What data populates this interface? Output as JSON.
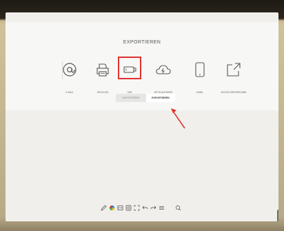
{
  "dialog": {
    "title": "EXPORTIEREN"
  },
  "options": [
    {
      "label": "E-MAIL",
      "icon": "at-sign-icon"
    },
    {
      "label": "DRUCKEN",
      "icon": "printer-icon"
    },
    {
      "label": "USB",
      "icon": "usb-drive-icon"
    },
    {
      "label": "NETZLAUFWERK",
      "icon": "cloud-icon"
    },
    {
      "label": "MOBIL",
      "icon": "mobile-phone-icon"
    },
    {
      "label": "BILDSCHIRMFREIGABE",
      "icon": "share-screen-icon"
    }
  ],
  "tabs": [
    {
      "label": "IMPORTIEREN",
      "active": false
    },
    {
      "label": "EXPORTIEREN",
      "active": true
    }
  ],
  "colors": {
    "highlight": "#e0312e",
    "arrow": "#e0312e"
  },
  "toolbar": [
    {
      "icon": "pen-icon"
    },
    {
      "icon": "color-picker-icon"
    },
    {
      "icon": "background-icon"
    },
    {
      "icon": "screenshot-icon"
    },
    {
      "icon": "fit-screen-icon"
    },
    {
      "icon": "undo-icon"
    },
    {
      "icon": "redo-icon"
    },
    {
      "icon": "menu-icon"
    },
    {
      "icon": "search-icon"
    }
  ]
}
